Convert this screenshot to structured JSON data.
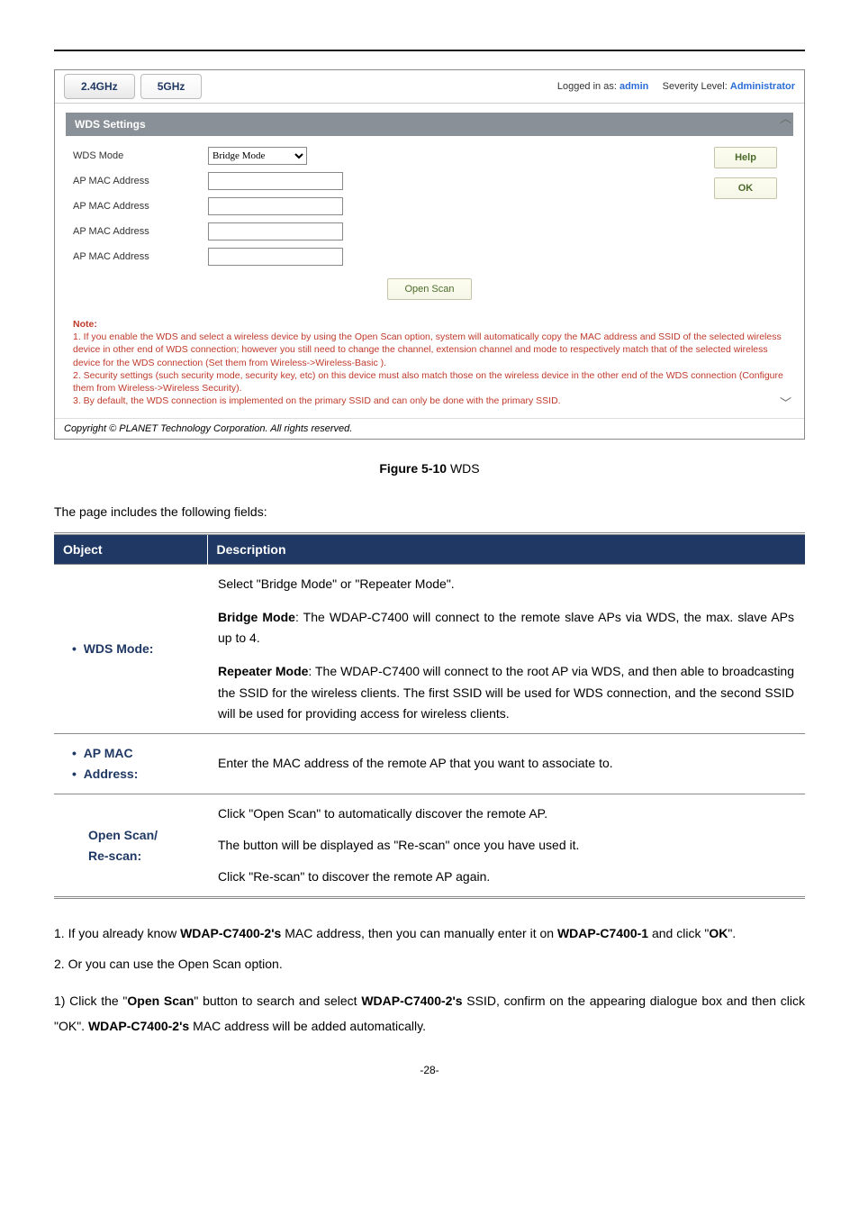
{
  "header": {
    "tab_24": "2.4GHz",
    "tab_5": "5GHz",
    "logged_in_label": "Logged in as:",
    "logged_in_user": "admin",
    "severity_label": "Severity Level:",
    "severity_value": "Administrator"
  },
  "section_title": "WDS Settings",
  "form": {
    "wds_mode_label": "WDS Mode",
    "wds_mode_value": "Bridge Mode",
    "ap_mac_label": "AP MAC Address"
  },
  "buttons": {
    "help": "Help",
    "ok": "OK",
    "open_scan": "Open Scan"
  },
  "note": {
    "title": "Note:",
    "line1": "1. If you enable the WDS and select a wireless device by using the Open Scan option, system will automatically copy the MAC address and SSID of the selected wireless device in other end of WDS connection; however you still need to change the channel, extension channel and mode to respectively match that of the selected wireless device for the WDS connection (Set them from Wireless->Wireless-Basic ).",
    "line2": "2. Security settings (such security mode, security key, etc) on this device must also match those on the wireless device in the other end of the WDS connection (Configure them from Wireless->Wireless Security).",
    "line3": "3. By default, the WDS connection is implemented on the primary SSID and can only be done with the primary SSID."
  },
  "copyright": "Copyright © PLANET Technology Corporation. All rights reserved.",
  "figure": {
    "label": "Figure 5-10",
    "title": " WDS"
  },
  "intro": "The page includes the following fields:",
  "table": {
    "h1": "Object",
    "h2": "Description",
    "rows": [
      {
        "obj": "WDS Mode:",
        "desc_intro": "Select \"Bridge Mode\" or \"Repeater Mode\".",
        "bridge_label": "Bridge Mode",
        "bridge_text": ": The WDAP-C7400 will connect to the remote slave APs via WDS, the max. slave APs up to 4.",
        "repeater_label": "Repeater Mode",
        "repeater_text": ": The WDAP-C7400 will connect to the root AP via WDS, and then able to broadcasting the SSID for the wireless clients. The first SSID will be used for WDS connection, and the second SSID will be used for providing access for wireless clients."
      },
      {
        "obj1": "AP MAC",
        "obj2": "Address:",
        "desc": "Enter the MAC address of the remote AP that you want to associate to."
      },
      {
        "obj1": "Open Scan/",
        "obj2": "Re-scan:",
        "d1": "Click \"Open Scan\" to automatically discover the remote AP.",
        "d2": "The button will be displayed as \"Re-scan\" once you have used it.",
        "d3": "Click \"Re-scan\" to discover the remote AP again."
      }
    ]
  },
  "body": {
    "p1a": "1. If you already know ",
    "p1b": "WDAP-C7400-2's",
    "p1c": " MAC address, then you can manually enter it on ",
    "p1d": "WDAP-C7400-1",
    "p1e": " and click \"",
    "p1f": "OK",
    "p1g": "\".",
    "p2": "2. Or you can use the Open Scan option.",
    "p3a": "1) Click the \"",
    "p3b": "Open Scan",
    "p3c": "\" button to search and select ",
    "p3d": "WDAP-C7400-2's",
    "p3e": " SSID, confirm on the appearing dialogue box and then click \"OK\". ",
    "p3f": "WDAP-C7400-2's",
    "p3g": " MAC address will be added automatically."
  },
  "pagenum": "-28-"
}
